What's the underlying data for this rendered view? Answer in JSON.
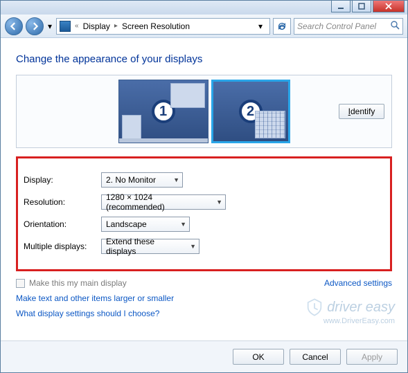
{
  "titlebar": {},
  "nav": {
    "breadcrumb_root": "«",
    "breadcrumb_1": "Display",
    "breadcrumb_2": "Screen Resolution",
    "search_placeholder": "Search Control Panel"
  },
  "heading": "Change the appearance of your displays",
  "monitors": {
    "m1": "1",
    "m2": "2"
  },
  "identify_label": "Identify",
  "labels": {
    "display": "Display:",
    "resolution": "Resolution:",
    "orientation": "Orientation:",
    "multiple": "Multiple displays:"
  },
  "values": {
    "display": "2. No Monitor",
    "resolution": "1280 × 1024 (recommended)",
    "orientation": "Landscape",
    "multiple": "Extend these displays"
  },
  "checkbox_label": "Make this my main display",
  "advanced_link": "Advanced settings",
  "link1": "Make text and other items larger or smaller",
  "link2": "What display settings should I choose?",
  "buttons": {
    "ok": "OK",
    "cancel": "Cancel",
    "apply": "Apply"
  },
  "watermark": {
    "brand": "driver easy",
    "url": "www.DriverEasy.com"
  }
}
